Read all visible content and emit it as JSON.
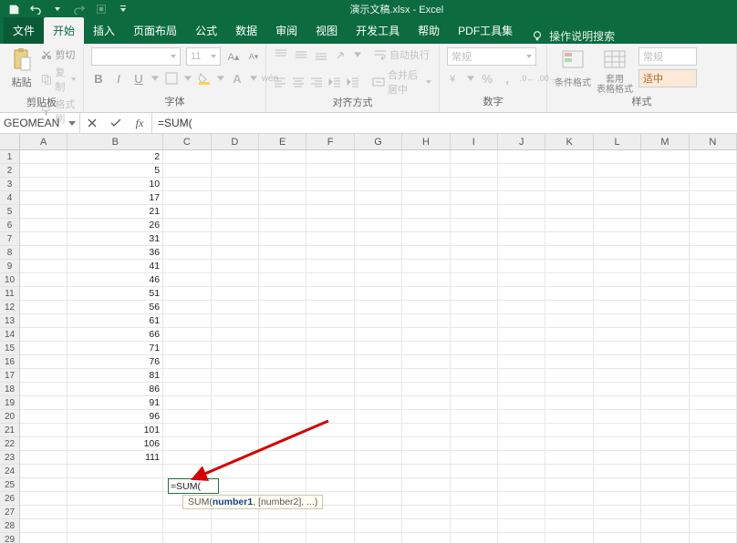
{
  "app": {
    "title": "演示文稿.xlsx - Excel"
  },
  "qat": {
    "save": "save-icon",
    "undo": "undo-icon",
    "redo": "redo-icon"
  },
  "tabs": {
    "file": "文件",
    "home": "开始",
    "insert": "插入",
    "layout": "页面布局",
    "formulas": "公式",
    "data": "数据",
    "review": "审阅",
    "view": "视图",
    "developer": "开发工具",
    "help": "帮助",
    "pdf": "PDF工具集",
    "tell": "操作说明搜索"
  },
  "ribbon": {
    "clipboard": {
      "label": "剪贴板",
      "paste": "粘贴",
      "cut": "剪切",
      "copy": "复制",
      "format_painter": "格式刷"
    },
    "font": {
      "label": "字体",
      "family": "",
      "size": "11",
      "bold": "B",
      "italic": "I",
      "underline": "U"
    },
    "alignment": {
      "label": "对齐方式",
      "wrap": "自动执行",
      "merge": "合并后居中"
    },
    "number": {
      "label": "数字",
      "format": "常规"
    },
    "styles": {
      "cond": "条件格式",
      "table": "套用\n表格格式",
      "normal": "常规",
      "neutral": "适中"
    },
    "rightlabel": "样式"
  },
  "formula_bar": {
    "name": "GEOMEAN",
    "formula": "=SUM("
  },
  "columns": [
    "A",
    "B",
    "C",
    "D",
    "E",
    "F",
    "G",
    "H",
    "I",
    "J",
    "K",
    "L",
    "M",
    "N"
  ],
  "rows_count": 29,
  "dataB": [
    "2",
    "5",
    "10",
    "17",
    "21",
    "26",
    "31",
    "36",
    "41",
    "46",
    "51",
    "56",
    "61",
    "66",
    "71",
    "76",
    "81",
    "86",
    "91",
    "96",
    "101",
    "106",
    "111"
  ],
  "edit": {
    "value": "=SUM(",
    "tooltip_fn": "SUM(",
    "tooltip_arg1": "number1",
    "tooltip_rest": ", [number2], ...)"
  }
}
